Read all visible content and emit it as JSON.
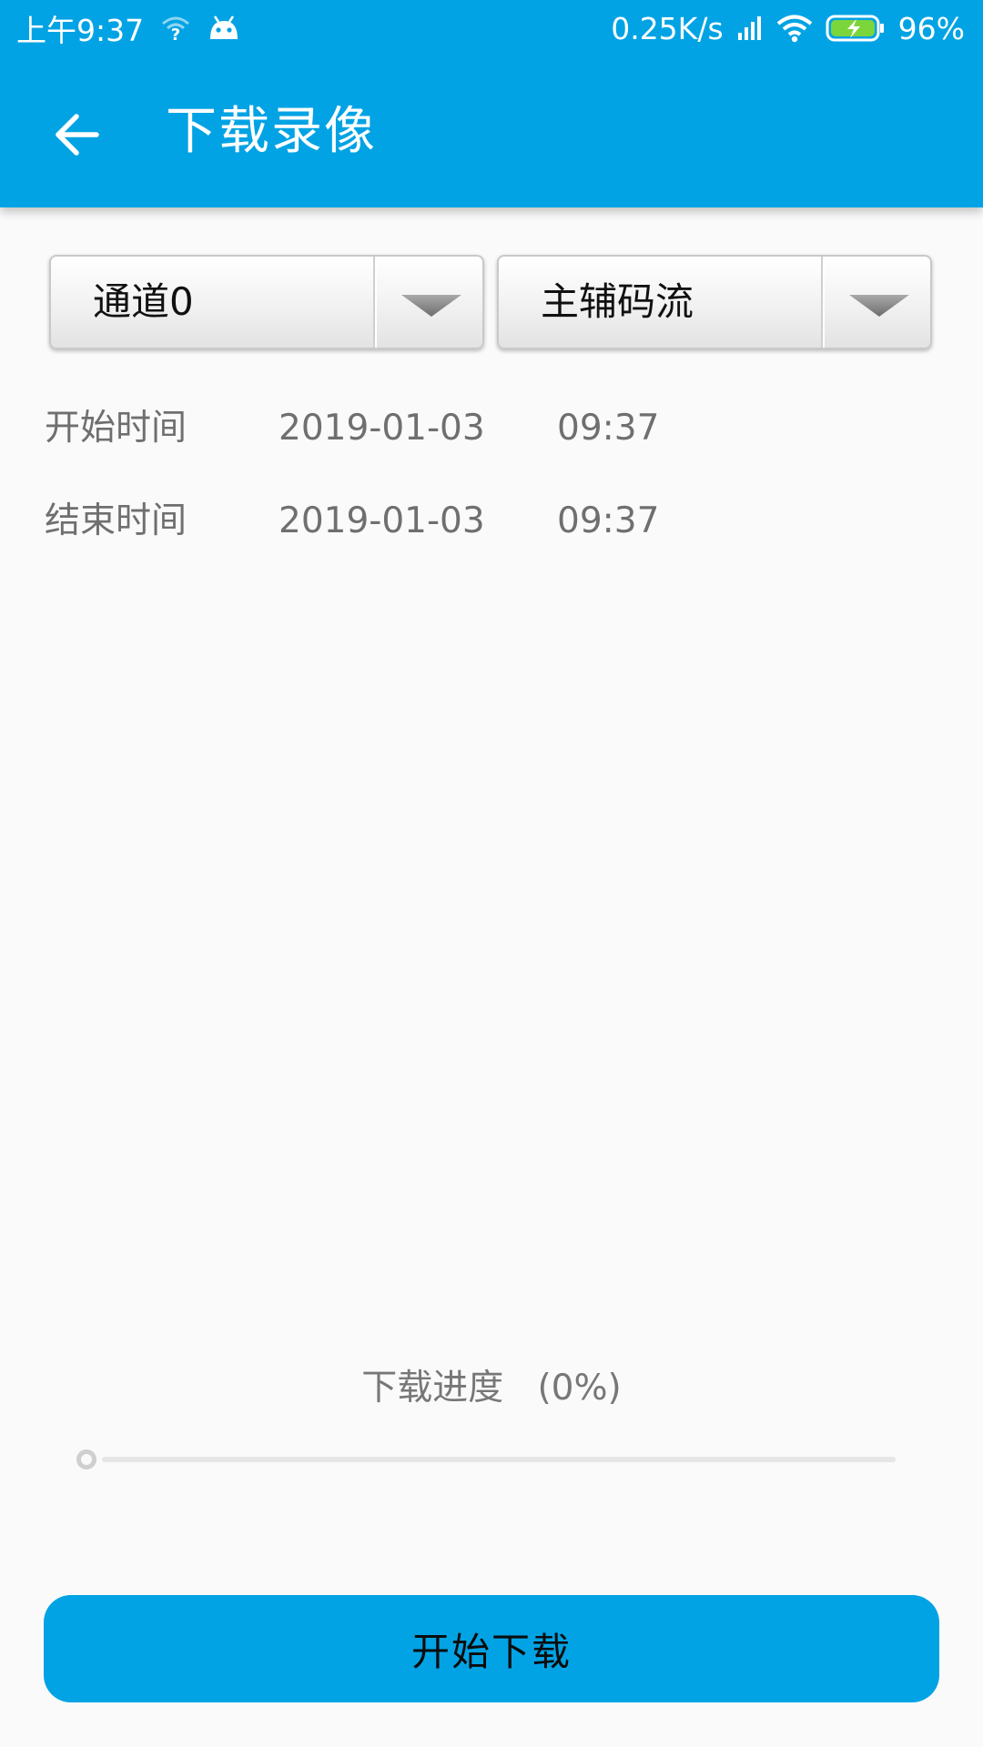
{
  "status_bar": {
    "time": "上午9:37",
    "net_speed": "0.25K/s",
    "battery": "96%",
    "icons": [
      "wifi-question-icon",
      "android-icon",
      "signal-icon",
      "wifi-icon",
      "battery-charging-icon"
    ]
  },
  "app_bar": {
    "title": "下载录像",
    "back_icon": "arrow-left-icon"
  },
  "spinners": {
    "channel": "通道0",
    "stream": "主辅码流",
    "arrow_icon": "triangle-down-icon"
  },
  "time_range": {
    "start": {
      "label": "开始时间",
      "date": "2019-01-03",
      "time": "09:37"
    },
    "end": {
      "label": "结束时间",
      "date": "2019-01-03",
      "time": "09:37"
    }
  },
  "progress": {
    "label": "下载进度   (0%)",
    "value": 0
  },
  "actions": {
    "start_download": "开始下载"
  },
  "colors": {
    "primary": "#02a3e4",
    "background": "#fafafa",
    "secondary_text": "#6f6f6f"
  }
}
